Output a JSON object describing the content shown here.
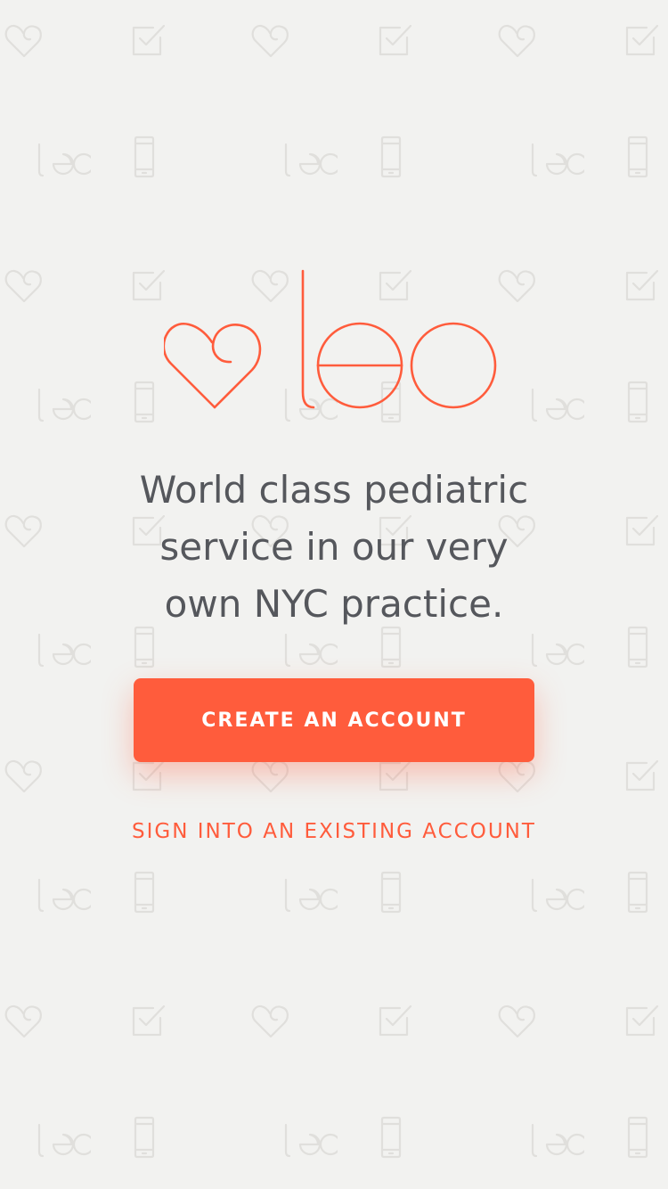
{
  "brand": {
    "name": "leo",
    "accent_color": "#ff5c3c",
    "logo_icon": "heart-outline-icon"
  },
  "background": {
    "color": "#f2f2f0",
    "pattern_icons": [
      "heart-outline-icon",
      "checkbox-icon",
      "leo-wordmark",
      "phone-icon"
    ]
  },
  "tagline": {
    "lines": [
      "World class pediatric",
      "service in our very",
      "own NYC practice."
    ]
  },
  "actions": {
    "create_account_label": "CREATE AN ACCOUNT",
    "sign_in_label": "SIGN INTO AN EXISTING ACCOUNT"
  }
}
